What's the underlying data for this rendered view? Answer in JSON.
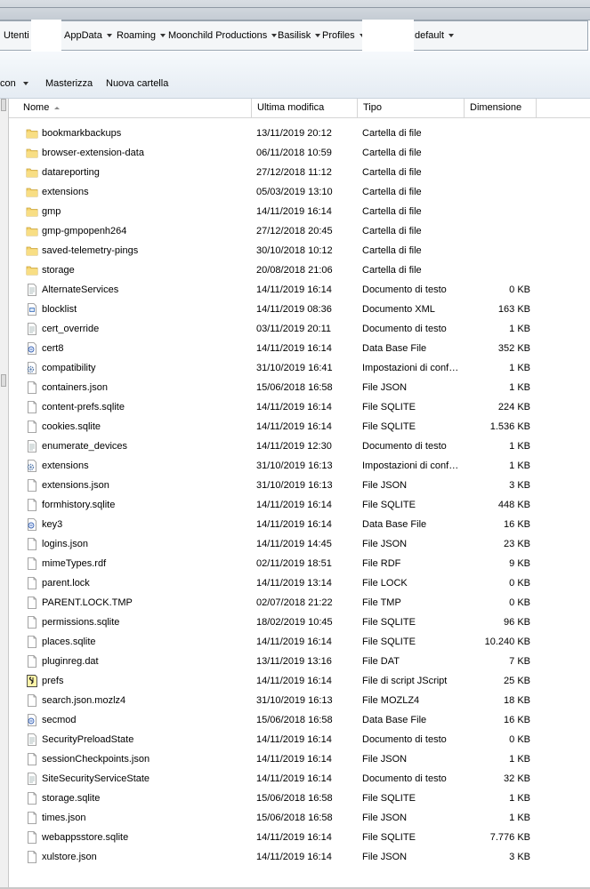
{
  "addressbar": {
    "crumbs": [
      "Utenti",
      "AppData",
      "Roaming",
      "Moonchild Productions",
      "Basilisk",
      "Profiles",
      "default"
    ]
  },
  "toolbar": {
    "view_label": "con",
    "burn_label": "Masterizza",
    "new_folder_label": "Nuova cartella"
  },
  "columns": {
    "name": "Nome",
    "modified": "Ultima modifica",
    "type": "Tipo",
    "size": "Dimensione"
  },
  "files": [
    {
      "name": "bookmarkbackups",
      "date": "13/11/2019 20:12",
      "type": "Cartella di file",
      "size": "",
      "icon": "folder-icon"
    },
    {
      "name": "browser-extension-data",
      "date": "06/11/2018 10:59",
      "type": "Cartella di file",
      "size": "",
      "icon": "folder-icon"
    },
    {
      "name": "datareporting",
      "date": "27/12/2018 11:12",
      "type": "Cartella di file",
      "size": "",
      "icon": "folder-icon"
    },
    {
      "name": "extensions",
      "date": "05/03/2019 13:10",
      "type": "Cartella di file",
      "size": "",
      "icon": "folder-icon"
    },
    {
      "name": "gmp",
      "date": "14/11/2019 16:14",
      "type": "Cartella di file",
      "size": "",
      "icon": "folder-icon"
    },
    {
      "name": "gmp-gmpopenh264",
      "date": "27/12/2018 20:45",
      "type": "Cartella di file",
      "size": "",
      "icon": "folder-icon"
    },
    {
      "name": "saved-telemetry-pings",
      "date": "30/10/2018 10:12",
      "type": "Cartella di file",
      "size": "",
      "icon": "folder-icon"
    },
    {
      "name": "storage",
      "date": "20/08/2018 21:06",
      "type": "Cartella di file",
      "size": "",
      "icon": "folder-icon"
    },
    {
      "name": "AlternateServices",
      "date": "14/11/2019 16:14",
      "type": "Documento di testo",
      "size": "0 KB",
      "icon": "text-file-icon"
    },
    {
      "name": "blocklist",
      "date": "14/11/2019 08:36",
      "type": "Documento XML",
      "size": "163 KB",
      "icon": "xml-file-icon"
    },
    {
      "name": "cert_override",
      "date": "03/11/2019 20:11",
      "type": "Documento di testo",
      "size": "1 KB",
      "icon": "text-file-icon"
    },
    {
      "name": "cert8",
      "date": "14/11/2019 16:14",
      "type": "Data Base File",
      "size": "352 KB",
      "icon": "database-file-icon"
    },
    {
      "name": "compatibility",
      "date": "31/10/2019 16:41",
      "type": "Impostazioni di conf…",
      "size": "1 KB",
      "icon": "settings-file-icon"
    },
    {
      "name": "containers.json",
      "date": "15/06/2018 16:58",
      "type": "File JSON",
      "size": "1 KB",
      "icon": "blank-file-icon"
    },
    {
      "name": "content-prefs.sqlite",
      "date": "14/11/2019 16:14",
      "type": "File SQLITE",
      "size": "224 KB",
      "icon": "blank-file-icon"
    },
    {
      "name": "cookies.sqlite",
      "date": "14/11/2019 16:14",
      "type": "File SQLITE",
      "size": "1.536 KB",
      "icon": "blank-file-icon"
    },
    {
      "name": "enumerate_devices",
      "date": "14/11/2019 12:30",
      "type": "Documento di testo",
      "size": "1 KB",
      "icon": "text-file-icon"
    },
    {
      "name": "extensions",
      "date": "31/10/2019 16:13",
      "type": "Impostazioni di conf…",
      "size": "1 KB",
      "icon": "settings-file-icon"
    },
    {
      "name": "extensions.json",
      "date": "31/10/2019 16:13",
      "type": "File JSON",
      "size": "3 KB",
      "icon": "blank-file-icon"
    },
    {
      "name": "formhistory.sqlite",
      "date": "14/11/2019 16:14",
      "type": "File SQLITE",
      "size": "448 KB",
      "icon": "blank-file-icon"
    },
    {
      "name": "key3",
      "date": "14/11/2019 16:14",
      "type": "Data Base File",
      "size": "16 KB",
      "icon": "database-file-icon"
    },
    {
      "name": "logins.json",
      "date": "14/11/2019 14:45",
      "type": "File JSON",
      "size": "23 KB",
      "icon": "blank-file-icon"
    },
    {
      "name": "mimeTypes.rdf",
      "date": "02/11/2019 18:51",
      "type": "File RDF",
      "size": "9 KB",
      "icon": "blank-file-icon"
    },
    {
      "name": "parent.lock",
      "date": "14/11/2019 13:14",
      "type": "File LOCK",
      "size": "0 KB",
      "icon": "blank-file-icon"
    },
    {
      "name": "PARENT.LOCK.TMP",
      "date": "02/07/2018 21:22",
      "type": "File TMP",
      "size": "0 KB",
      "icon": "blank-file-icon"
    },
    {
      "name": "permissions.sqlite",
      "date": "18/02/2019 10:45",
      "type": "File SQLITE",
      "size": "96 KB",
      "icon": "blank-file-icon"
    },
    {
      "name": "places.sqlite",
      "date": "14/11/2019 16:14",
      "type": "File SQLITE",
      "size": "10.240 KB",
      "icon": "blank-file-icon"
    },
    {
      "name": "pluginreg.dat",
      "date": "13/11/2019 13:16",
      "type": "File DAT",
      "size": "7 KB",
      "icon": "blank-file-icon"
    },
    {
      "name": "prefs",
      "date": "14/11/2019 16:14",
      "type": "File di script JScript",
      "size": "25 KB",
      "icon": "script-file-icon"
    },
    {
      "name": "search.json.mozlz4",
      "date": "31/10/2019 16:13",
      "type": "File MOZLZ4",
      "size": "18 KB",
      "icon": "blank-file-icon"
    },
    {
      "name": "secmod",
      "date": "15/06/2018 16:58",
      "type": "Data Base File",
      "size": "16 KB",
      "icon": "database-file-icon"
    },
    {
      "name": "SecurityPreloadState",
      "date": "14/11/2019 16:14",
      "type": "Documento di testo",
      "size": "0 KB",
      "icon": "text-file-icon"
    },
    {
      "name": "sessionCheckpoints.json",
      "date": "14/11/2019 16:14",
      "type": "File JSON",
      "size": "1 KB",
      "icon": "blank-file-icon"
    },
    {
      "name": "SiteSecurityServiceState",
      "date": "14/11/2019 16:14",
      "type": "Documento di testo",
      "size": "32 KB",
      "icon": "text-file-icon"
    },
    {
      "name": "storage.sqlite",
      "date": "15/06/2018 16:58",
      "type": "File SQLITE",
      "size": "1 KB",
      "icon": "blank-file-icon"
    },
    {
      "name": "times.json",
      "date": "15/06/2018 16:58",
      "type": "File JSON",
      "size": "1 KB",
      "icon": "blank-file-icon"
    },
    {
      "name": "webappsstore.sqlite",
      "date": "14/11/2019 16:14",
      "type": "File SQLITE",
      "size": "7.776 KB",
      "icon": "blank-file-icon"
    },
    {
      "name": "xulstore.json",
      "date": "14/11/2019 16:14",
      "type": "File JSON",
      "size": "3 KB",
      "icon": "blank-file-icon"
    }
  ]
}
